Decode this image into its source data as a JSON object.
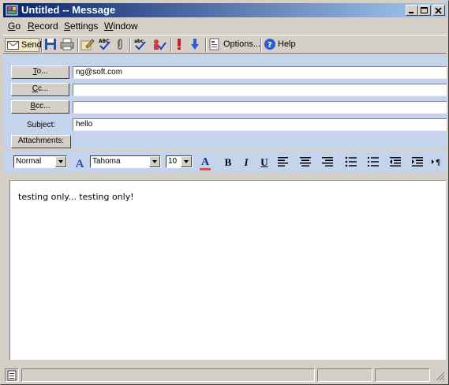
{
  "window": {
    "title": "Untitled -- Message"
  },
  "menu": [
    {
      "label": "Go",
      "accel": "G",
      "rest": "o"
    },
    {
      "label": "Record",
      "accel": "R",
      "rest": "ecord"
    },
    {
      "label": "Settings",
      "accel": "S",
      "rest": "ettings"
    },
    {
      "label": "Window",
      "accel": "W",
      "rest": "indow"
    }
  ],
  "toolbar": {
    "send_label": "Send",
    "options_label": "Options...",
    "help_label": "Help"
  },
  "header": {
    "to_button": {
      "accel": "T",
      "rest": "o..."
    },
    "cc_button": {
      "accel": "C",
      "rest": "c..."
    },
    "bcc_button": {
      "accel": "B",
      "rest": "cc..."
    },
    "to_value": "ng@soft.com",
    "cc_value": "",
    "bcc_value": "",
    "subject_label": "Subject:",
    "subject_value": "hello",
    "attachments_label": "Attachments:"
  },
  "format": {
    "paragraph_style": "Normal",
    "font_name": "Tahoma",
    "font_size": "10",
    "bold_glyph": "B",
    "italic_glyph": "I",
    "underline_glyph": "U",
    "font_color_glyph": "A",
    "colors": {
      "font_color_bar": "#e8502a"
    }
  },
  "body_text": "testing only... testing only!",
  "colors": {
    "titlebar_start": "#0a246a",
    "titlebar_end": "#a6caf0",
    "header_bg": "#c4d4ec",
    "send_bg": "#f2e8c4"
  }
}
